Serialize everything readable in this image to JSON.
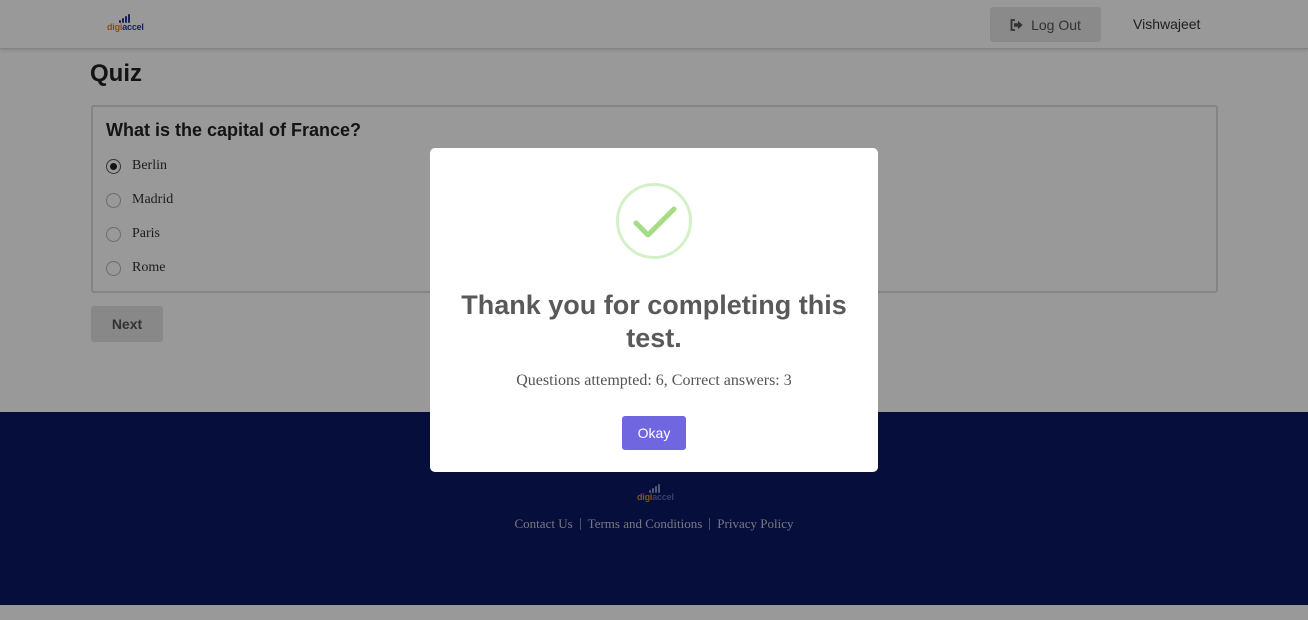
{
  "header": {
    "logo": {
      "text_part1": "digi",
      "text_part2": "accel"
    },
    "logout_label": "Log Out",
    "username": "Vishwajeet"
  },
  "main": {
    "title": "Quiz",
    "question": "What is the capital of France?",
    "options": [
      {
        "label": "Berlin",
        "selected": true
      },
      {
        "label": "Madrid",
        "selected": false
      },
      {
        "label": "Paris",
        "selected": false
      },
      {
        "label": "Rome",
        "selected": false
      }
    ],
    "next_label": "Next"
  },
  "footer": {
    "logo": {
      "text_part1": "digi",
      "text_part2": "accel"
    },
    "links": [
      "Contact Us",
      "Terms and Conditions",
      "Privacy Policy"
    ]
  },
  "modal": {
    "title": "Thank you for completing this test.",
    "summary": "Questions attempted: 6, Correct answers: 3",
    "okay_label": "Okay"
  },
  "colors": {
    "footer_bg": "#0b1a63",
    "modal_button": "#7066e0",
    "success_check": "#a5dc86",
    "logo_orange": "#e8832a",
    "logo_navy": "#2e3a8c"
  }
}
